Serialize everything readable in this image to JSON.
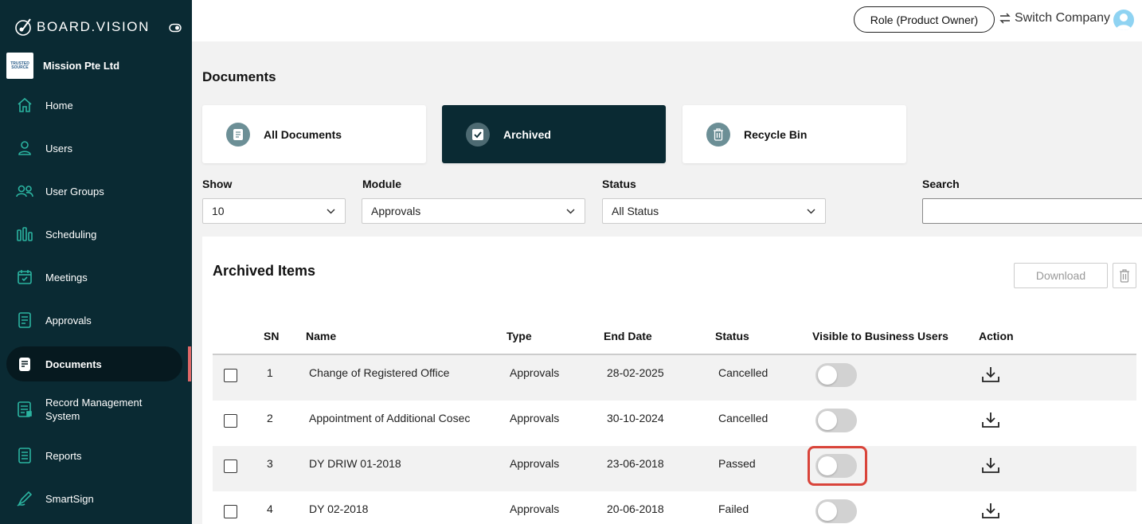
{
  "app": {
    "logo_text": "BOARD.VISION",
    "company_logo_text": "TRUSTED SOURCE",
    "company_name": "Mission Pte Ltd"
  },
  "sidebar": {
    "items": [
      {
        "label": "Home",
        "icon": "home-icon"
      },
      {
        "label": "Users",
        "icon": "user-icon"
      },
      {
        "label": "User Groups",
        "icon": "user-group-icon"
      },
      {
        "label": "Scheduling",
        "icon": "scheduling-icon"
      },
      {
        "label": "Meetings",
        "icon": "calendar-check-icon"
      },
      {
        "label": "Approvals",
        "icon": "approvals-icon"
      },
      {
        "label": "Documents",
        "icon": "documents-icon",
        "active": true
      },
      {
        "label": "Record Management System",
        "icon": "record-icon"
      },
      {
        "label": "Reports",
        "icon": "reports-icon"
      },
      {
        "label": "SmartSign",
        "icon": "pen-icon"
      }
    ]
  },
  "header": {
    "role": "Role (Product Owner)",
    "switch_company": "Switch Company"
  },
  "page": {
    "title": "Documents"
  },
  "tabs": [
    {
      "label": "All Documents",
      "icon": "document-icon"
    },
    {
      "label": "Archived",
      "icon": "checkbox-icon",
      "active": true
    },
    {
      "label": "Recycle Bin",
      "icon": "trash-icon"
    }
  ],
  "filters": {
    "show": {
      "label": "Show",
      "value": "10"
    },
    "module": {
      "label": "Module",
      "value": "Approvals"
    },
    "status": {
      "label": "Status",
      "value": "All Status"
    },
    "search": {
      "label": "Search",
      "value": ""
    }
  },
  "panel": {
    "title": "Archived Items",
    "download": "Download"
  },
  "table": {
    "headers": {
      "sn": "SN",
      "name": "Name",
      "type": "Type",
      "end_date": "End Date",
      "status": "Status",
      "visible": "Visible to Business Users",
      "action": "Action"
    },
    "rows": [
      {
        "sn": "1",
        "name": "Change of Registered Office",
        "type": "Approvals",
        "end_date": "28-02-2025",
        "status": "Cancelled",
        "visible": false
      },
      {
        "sn": "2",
        "name": "Appointment of Additional Cosec",
        "type": "Approvals",
        "end_date": "30-10-2024",
        "status": "Cancelled",
        "visible": false
      },
      {
        "sn": "3",
        "name": "DY DRIW 01-2018",
        "type": "Approvals",
        "end_date": "23-06-2018",
        "status": "Passed",
        "visible": false,
        "highlighted": true
      },
      {
        "sn": "4",
        "name": "DY 02-2018",
        "type": "Approvals",
        "end_date": "20-06-2018",
        "status": "Failed",
        "visible": false
      }
    ]
  },
  "colors": {
    "sidebar": "#0a2a33",
    "active_tab": "#0a2a33",
    "highlight": "#d9443a",
    "accent": "#2bb3a0"
  }
}
